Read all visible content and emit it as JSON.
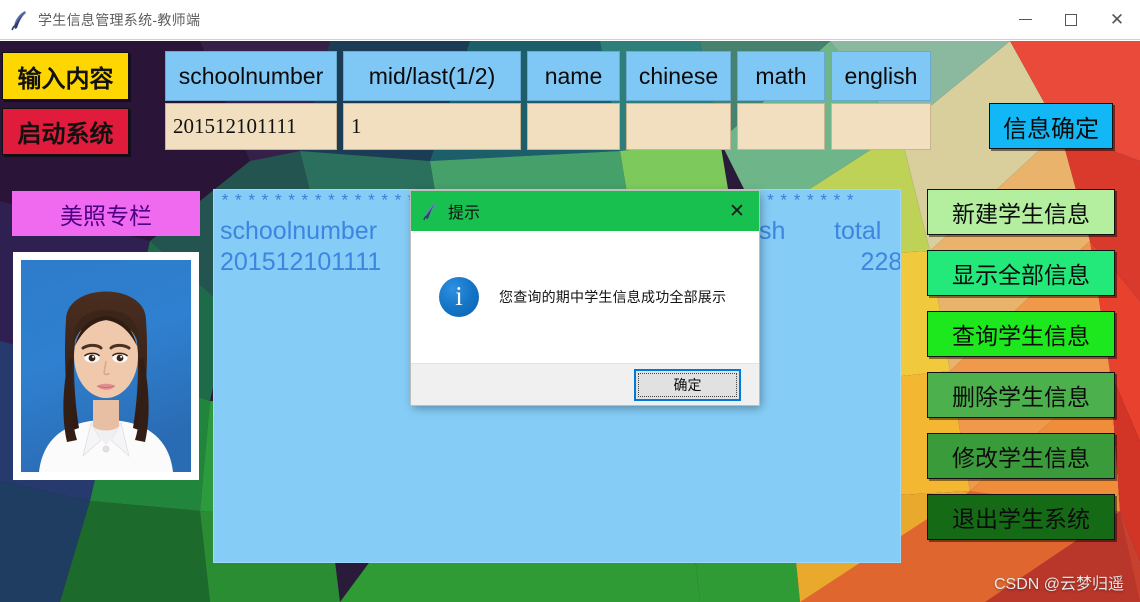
{
  "window": {
    "title": "学生信息管理系统-教师端",
    "icon": "feather-icon",
    "controls": {
      "minimize": "—",
      "maximize": "□",
      "close": "✕"
    }
  },
  "toolbar": {
    "input_label": "输入内容",
    "start_label": "启动系统",
    "confirm_label": "信息确定"
  },
  "fields": [
    {
      "key": "schoolnumber",
      "label": "schoolnumber",
      "value": "201512101111",
      "placeholder": ""
    },
    {
      "key": "midlast",
      "label": "mid/last(1/2)",
      "value": "1",
      "placeholder": ""
    },
    {
      "key": "name",
      "label": "name",
      "value": "",
      "placeholder": ""
    },
    {
      "key": "chinese",
      "label": "chinese",
      "value": "",
      "placeholder": ""
    },
    {
      "key": "math",
      "label": "math",
      "value": "",
      "placeholder": ""
    },
    {
      "key": "english",
      "label": "english",
      "value": "",
      "placeholder": ""
    }
  ],
  "photo_panel": {
    "header": "美照专栏",
    "image_alt": "student-portrait"
  },
  "content": {
    "separator": "************************************************",
    "row1": "schoolnumber                                                       sh       total",
    "row2": "201512101111                                                                     228"
  },
  "side_buttons": [
    {
      "label": "新建学生信息",
      "color": "#B4EFA0"
    },
    {
      "label": "显示全部信息",
      "color": "#23E97B"
    },
    {
      "label": "查询学生信息",
      "color": "#1DE71D"
    },
    {
      "label": "删除学生信息",
      "color": "#4CB14C"
    },
    {
      "label": "修改学生信息",
      "color": "#3A9B3A"
    },
    {
      "label": "退出学生系统",
      "color": "#156B15"
    }
  ],
  "dialog": {
    "title": "提示",
    "icon": "feather-icon",
    "close": "✕",
    "info_glyph": "i",
    "message": "您查询的期中学生信息成功全部展示",
    "ok_label": "确定"
  },
  "watermark": "CSDN @云梦归遥"
}
